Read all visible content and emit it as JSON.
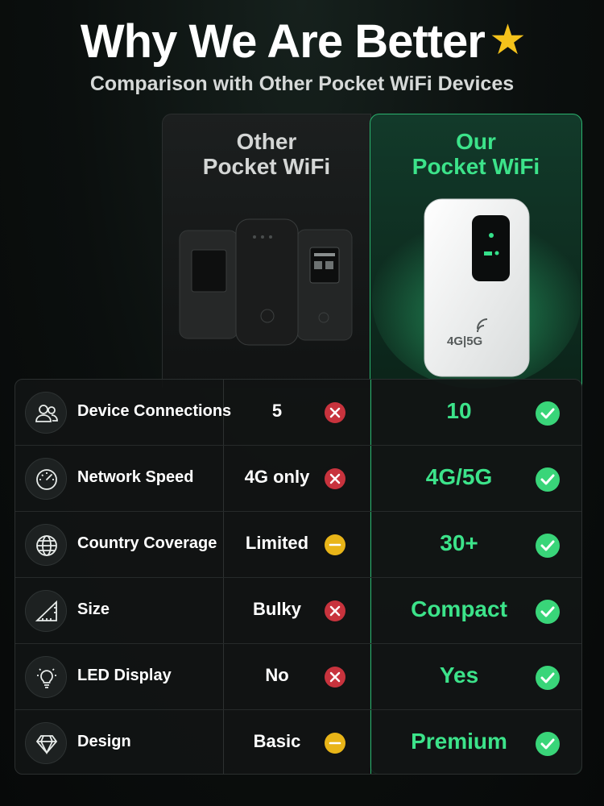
{
  "header": {
    "title": "Why We Are Better",
    "star_icon": "star-icon",
    "subtitle": "Comparison with Other Pocket WiFi Devices"
  },
  "columns": {
    "other": {
      "line1": "Other",
      "line2": "Pocket WiFi"
    },
    "ours": {
      "line1": "Our",
      "line2": "Pocket WiFi",
      "device_label": "4G|5G"
    }
  },
  "colors": {
    "accent_green": "#3ce38a",
    "cross_red": "#c8333d",
    "neutral_yellow": "#e9b518",
    "check_green": "#39d579"
  },
  "rows": [
    {
      "icon": "users-icon",
      "feature": "Device Connections",
      "other": "5",
      "other_mark": "cross",
      "ours": "10"
    },
    {
      "icon": "speedometer-icon",
      "feature": "Network Speed",
      "other": "4G only",
      "other_mark": "cross",
      "ours": "4G/5G"
    },
    {
      "icon": "globe-icon",
      "feature": "Country Coverage",
      "other": "Limited",
      "other_mark": "neutral",
      "ours": "30+"
    },
    {
      "icon": "size-ruler-icon",
      "feature": "Size",
      "other": "Bulky",
      "other_mark": "cross",
      "ours": "Compact"
    },
    {
      "icon": "lightbulb-icon",
      "feature": "LED Display",
      "other": "No",
      "other_mark": "cross",
      "ours": "Yes"
    },
    {
      "icon": "diamond-icon",
      "feature": "Design",
      "other": "Basic",
      "other_mark": "neutral",
      "ours": "Premium"
    }
  ]
}
